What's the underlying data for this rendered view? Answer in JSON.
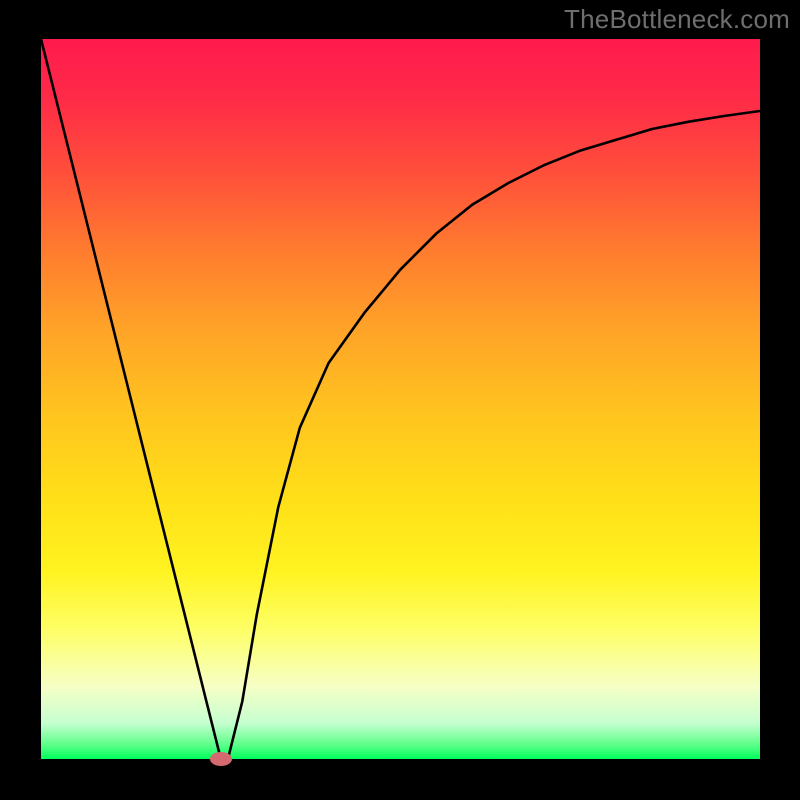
{
  "watermark": "TheBottleneck.com",
  "chart_data": {
    "type": "line",
    "title": "",
    "xlabel": "",
    "ylabel": "",
    "xlim": [
      0,
      100
    ],
    "ylim": [
      0,
      100
    ],
    "axes_visible": false,
    "background_gradient": {
      "orientation": "vertical",
      "stops": [
        {
          "offset": 0.0,
          "color": "#ff1a4d"
        },
        {
          "offset": 0.3,
          "color": "#ff7e2e"
        },
        {
          "offset": 0.6,
          "color": "#ffe018"
        },
        {
          "offset": 0.85,
          "color": "#feff66"
        },
        {
          "offset": 1.0,
          "color": "#00ff5c"
        }
      ]
    },
    "series": [
      {
        "name": "bottleneck-curve",
        "color": "#000000",
        "x": [
          0,
          5,
          10,
          15,
          20,
          23,
          25,
          26,
          28,
          30,
          33,
          36,
          40,
          45,
          50,
          55,
          60,
          65,
          70,
          75,
          80,
          85,
          90,
          95,
          100
        ],
        "y": [
          100,
          80,
          60,
          40,
          20,
          8,
          0,
          0,
          8,
          20,
          35,
          46,
          55,
          62,
          68,
          73,
          77,
          80,
          82.5,
          84.5,
          86,
          87.5,
          88.5,
          89.3,
          90
        ]
      }
    ],
    "markers": [
      {
        "name": "optimal-point",
        "x": 25,
        "y": 0,
        "color": "#d46a6f",
        "shape": "ellipse"
      }
    ]
  }
}
